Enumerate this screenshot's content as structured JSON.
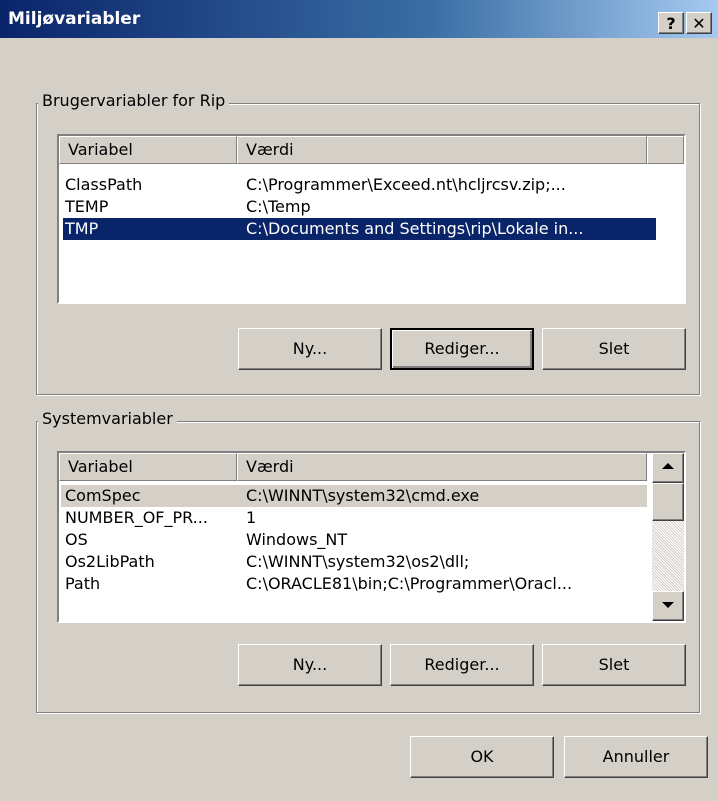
{
  "window": {
    "title": "Miljøvariabler",
    "help_glyph": "?",
    "close_glyph": "✕"
  },
  "user_vars": {
    "group_label": "Brugervariabler for Rip",
    "columns": [
      "Variabel",
      "Værdi"
    ],
    "rows": [
      {
        "name": "ClassPath",
        "value": "C:\\Programmer\\Exceed.nt\\hcljrcsv.zip;..."
      },
      {
        "name": "TEMP",
        "value": "C:\\Temp"
      },
      {
        "name": "TMP",
        "value": "C:\\Documents and Settings\\rip\\Lokale in..."
      }
    ],
    "selected_row": "TMP",
    "buttons": {
      "new": "Ny...",
      "edit": "Rediger...",
      "delete": "Slet"
    }
  },
  "system_vars": {
    "group_label": "Systemvariabler",
    "columns": [
      "Variabel",
      "Værdi"
    ],
    "rows": [
      {
        "name": "ComSpec",
        "value": "C:\\WINNT\\system32\\cmd.exe"
      },
      {
        "name": "NUMBER_OF_PR...",
        "value": "1"
      },
      {
        "name": "OS",
        "value": "Windows_NT"
      },
      {
        "name": "Os2LibPath",
        "value": "C:\\WINNT\\system32\\os2\\dll;"
      },
      {
        "name": "Path",
        "value": "C:\\ORACLE81\\bin;C:\\Programmer\\Oracl..."
      }
    ],
    "selected_row": "ComSpec",
    "buttons": {
      "new": "Ny...",
      "edit": "Rediger...",
      "delete": "Slet"
    }
  },
  "footer": {
    "ok": "OK",
    "cancel": "Annuller"
  }
}
